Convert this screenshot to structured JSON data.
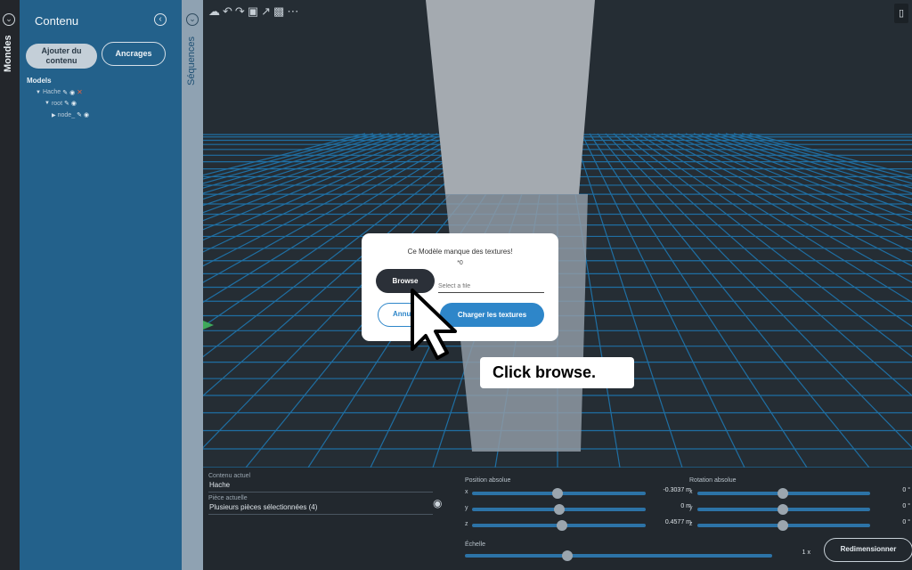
{
  "left_rail": {
    "label": "Mondes"
  },
  "content_panel": {
    "title": "Contenu",
    "add_button": "Ajouter du contenu",
    "anchors_button": "Ancrages",
    "models_header": "Models",
    "tree": [
      {
        "label": "Hache"
      },
      {
        "label": "root"
      },
      {
        "label": "node_"
      }
    ]
  },
  "sequences": {
    "label": "Séquences"
  },
  "modal": {
    "title": "Ce Modèle manque des textures!",
    "subtitle": "*0",
    "browse_label": "Browse",
    "file_placeholder": "Select a file",
    "cancel_label": "Annuler",
    "load_label": "Charger les textures"
  },
  "tooltip": {
    "text": "Click browse."
  },
  "bottom_panel": {
    "current_content_label": "Contenu actuel",
    "current_content_value": "Hache",
    "current_piece_label": "Pièce actuelle",
    "current_piece_value": "Plusieurs pièces sélectionnées (4)",
    "position_label": "Position absolue",
    "rotation_label": "Rotation absolue",
    "scale_label": "Échelle",
    "position": [
      {
        "axis": "x",
        "value": "-0.3037 m"
      },
      {
        "axis": "y",
        "value": "0 m"
      },
      {
        "axis": "z",
        "value": "0.4577 m"
      }
    ],
    "rotation": [
      {
        "axis": "x",
        "value": "0 °"
      },
      {
        "axis": "y",
        "value": "0 °"
      },
      {
        "axis": "z",
        "value": "0 °"
      }
    ],
    "scale_value": "1 x",
    "resize_label": "Redimensionner"
  },
  "colors": {
    "panel_blue": "#23618b",
    "accent_blue": "#2e86c9",
    "grid_line": "#1f6fa3",
    "slider_track": "#2c73a7"
  }
}
